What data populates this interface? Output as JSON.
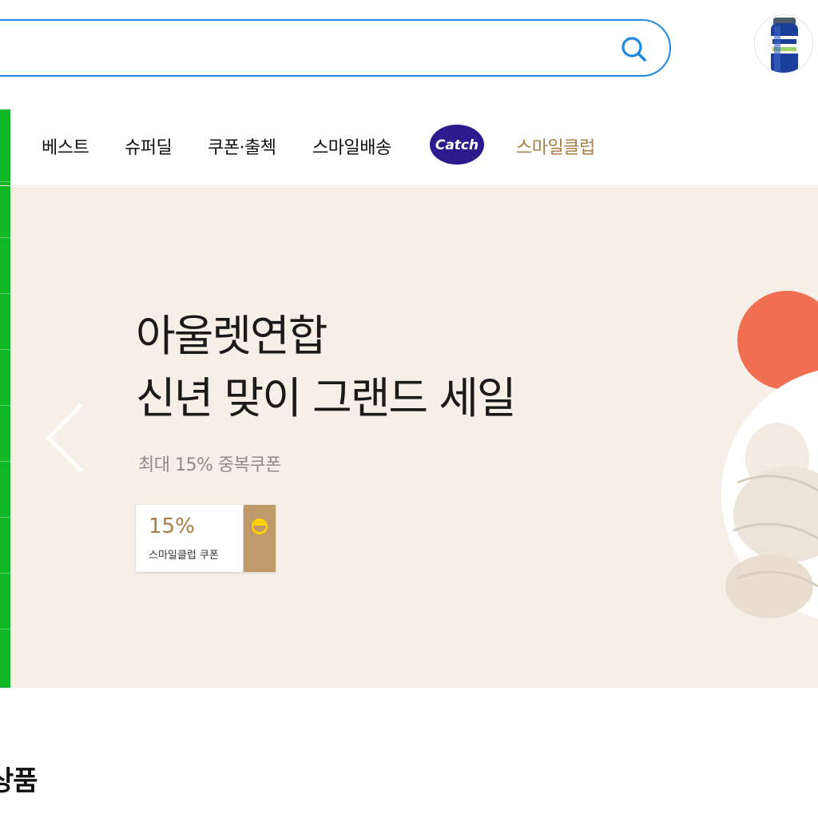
{
  "search": {
    "value": "",
    "placeholder": ""
  },
  "nav": {
    "items": [
      {
        "label": "베스트"
      },
      {
        "label": "슈퍼딜"
      },
      {
        "label": "쿠폰·출첵"
      },
      {
        "label": "스마일배송"
      }
    ],
    "catch_logo_text": "Catch",
    "club_label": "스마일클럽"
  },
  "banner": {
    "title_line1": "아울렛연합",
    "title_line2": "신년 맞이 그랜드 세일",
    "subtitle": "최대 15% 중복쿠폰",
    "coupon": {
      "percent": "15%",
      "label": "스마일클럽 쿠폰"
    }
  },
  "section": {
    "title": "상품"
  },
  "colors": {
    "accent_blue": "#1e88e5",
    "green_bar": "#0fb824",
    "club_gold": "#a87c43",
    "banner_bg": "#f6efe8",
    "coral": "#f06e52",
    "catch_purple": "#2d1a8c"
  }
}
